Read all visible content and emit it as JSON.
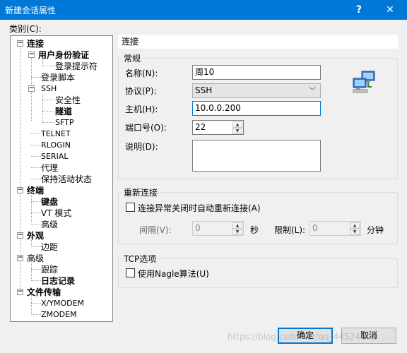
{
  "window": {
    "title": "新建会话属性",
    "help_label": "?",
    "close_label": "✕"
  },
  "category_label": "类别(C):",
  "tree": [
    {
      "label": "连接",
      "bold": true
    },
    {
      "label": "用户身份验证",
      "bold": true
    },
    {
      "label": "登录提示符",
      "bold": false
    },
    {
      "label": "登录脚本",
      "bold": false
    },
    {
      "label": "SSH",
      "bold": false
    },
    {
      "label": "安全性",
      "bold": false
    },
    {
      "label": "隧道",
      "bold": true
    },
    {
      "label": "SFTP",
      "bold": false
    },
    {
      "label": "TELNET",
      "bold": false
    },
    {
      "label": "RLOGIN",
      "bold": false
    },
    {
      "label": "SERIAL",
      "bold": false
    },
    {
      "label": "代理",
      "bold": false
    },
    {
      "label": "保持活动状态",
      "bold": false
    },
    {
      "label": "终端",
      "bold": true
    },
    {
      "label": "键盘",
      "bold": true
    },
    {
      "label": "VT 模式",
      "bold": false
    },
    {
      "label": "高级",
      "bold": false
    },
    {
      "label": "外观",
      "bold": true
    },
    {
      "label": "边距",
      "bold": false
    },
    {
      "label": "高级",
      "bold": false
    },
    {
      "label": "跟踪",
      "bold": false
    },
    {
      "label": "日志记录",
      "bold": true
    },
    {
      "label": "文件传输",
      "bold": true
    },
    {
      "label": "X/YMODEM",
      "bold": false
    },
    {
      "label": "ZMODEM",
      "bold": false
    }
  ],
  "section_title": "连接",
  "general": {
    "group_title": "常规",
    "name_label": "名称(N):",
    "name_value": "周10",
    "protocol_label": "协议(P):",
    "protocol_value": "SSH",
    "host_label": "主机(H):",
    "host_value": "10.0.0.200",
    "port_label": "端口号(O):",
    "port_value": "22",
    "desc_label": "说明(D):",
    "desc_value": ""
  },
  "reconnect": {
    "group_title": "重新连接",
    "checkbox_label": "连接异常关闭时自动重新连接(A)",
    "interval_label": "间隔(V):",
    "interval_value": "0",
    "interval_unit": "秒",
    "limit_label": "限制(L):",
    "limit_value": "0",
    "limit_unit": "分钟"
  },
  "tcp": {
    "group_title": "TCP选项",
    "nagle_label": "使用Nagle算法(U)"
  },
  "buttons": {
    "ok": "确定",
    "cancel": "取消"
  },
  "watermark": "https://blog.csdn.net/qq_44524645"
}
